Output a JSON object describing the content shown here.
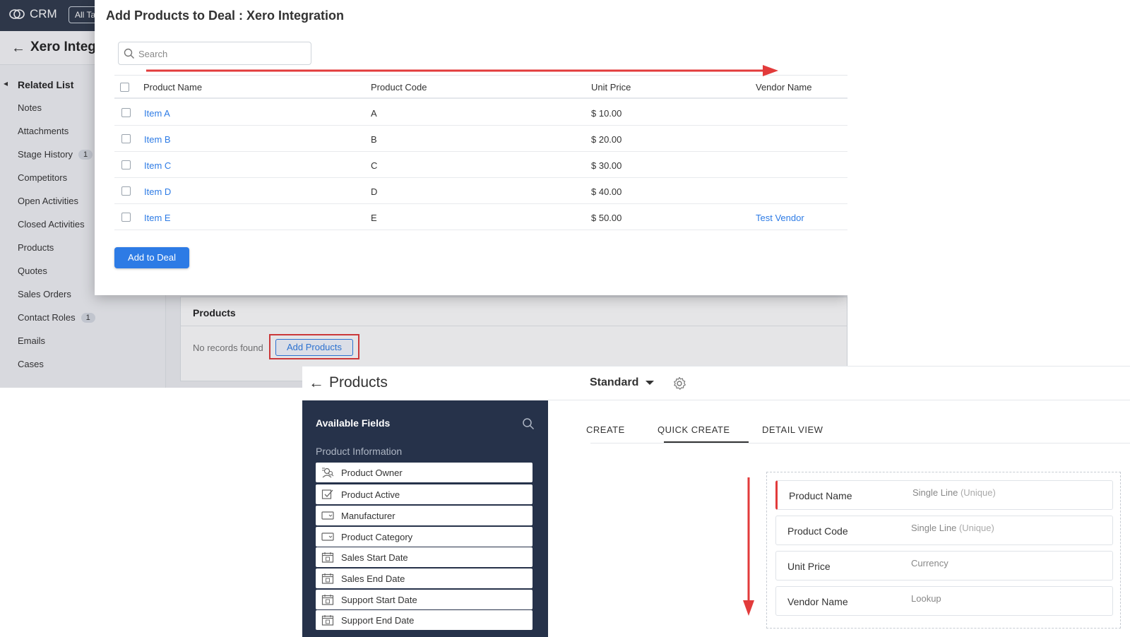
{
  "crm": {
    "logo_text": "CRM",
    "all_tab_label": "All Ta",
    "record_title": "Xero Integ",
    "related_list_title": "Related List",
    "nav_items": [
      {
        "label": "Notes",
        "badge": ""
      },
      {
        "label": "Attachments",
        "badge": ""
      },
      {
        "label": "Stage History",
        "badge": "1"
      },
      {
        "label": "Competitors",
        "badge": ""
      },
      {
        "label": "Open Activities",
        "badge": ""
      },
      {
        "label": "Closed Activities",
        "badge": ""
      },
      {
        "label": "Products",
        "badge": ""
      },
      {
        "label": "Quotes",
        "badge": ""
      },
      {
        "label": "Sales Orders",
        "badge": ""
      },
      {
        "label": "Contact Roles",
        "badge": "1"
      },
      {
        "label": "Emails",
        "badge": ""
      },
      {
        "label": "Cases",
        "badge": ""
      }
    ],
    "products_section": {
      "title": "Products",
      "empty_text": "No records found",
      "add_button": "Add Products"
    }
  },
  "modal": {
    "title": "Add Products to Deal : Xero Integration",
    "search_placeholder": "Search",
    "columns": [
      "Product Name",
      "Product Code",
      "Unit Price",
      "Vendor Name"
    ],
    "rows": [
      {
        "name": "Item A",
        "code": "A",
        "price": "$ 10.00",
        "vendor": ""
      },
      {
        "name": "Item B",
        "code": "B",
        "price": "$ 20.00",
        "vendor": ""
      },
      {
        "name": "Item C",
        "code": "C",
        "price": "$ 30.00",
        "vendor": ""
      },
      {
        "name": "Item D",
        "code": "D",
        "price": "$ 40.00",
        "vendor": ""
      },
      {
        "name": "Item E",
        "code": "E",
        "price": "$ 50.00",
        "vendor": "Test Vendor"
      }
    ],
    "submit_button": "Add to Deal"
  },
  "editor": {
    "title": "Products",
    "layout_name": "Standard",
    "panel": {
      "title": "Available Fields",
      "section": "Product Information",
      "fields": [
        {
          "label": "Product Owner",
          "icon": "user-lookup-icon"
        },
        {
          "label": "Product Active",
          "icon": "checkbox-icon"
        },
        {
          "label": "Manufacturer",
          "icon": "picklist-icon"
        },
        {
          "label": "Product Category",
          "icon": "picklist-icon"
        },
        {
          "label": "Sales Start Date",
          "icon": "calendar-icon"
        },
        {
          "label": "Sales End Date",
          "icon": "calendar-icon"
        },
        {
          "label": "Support Start Date",
          "icon": "calendar-icon"
        },
        {
          "label": "Support End Date",
          "icon": "calendar-icon"
        }
      ]
    },
    "tabs": [
      "CREATE",
      "QUICK CREATE",
      "DETAIL VIEW"
    ],
    "active_tab": "QUICK CREATE",
    "form_fields": [
      {
        "label": "Product Name",
        "type": "Single Line",
        "suffix": "(Unique)"
      },
      {
        "label": "Product Code",
        "type": "Single Line",
        "suffix": "(Unique)"
      },
      {
        "label": "Unit Price",
        "type": "Currency",
        "suffix": ""
      },
      {
        "label": "Vendor Name",
        "type": "Lookup",
        "suffix": ""
      }
    ]
  },
  "colors": {
    "header": "#2f3a4c",
    "accent": "#2d7be5",
    "annotation_red": "#e23b3b",
    "panel": "#26324a"
  }
}
